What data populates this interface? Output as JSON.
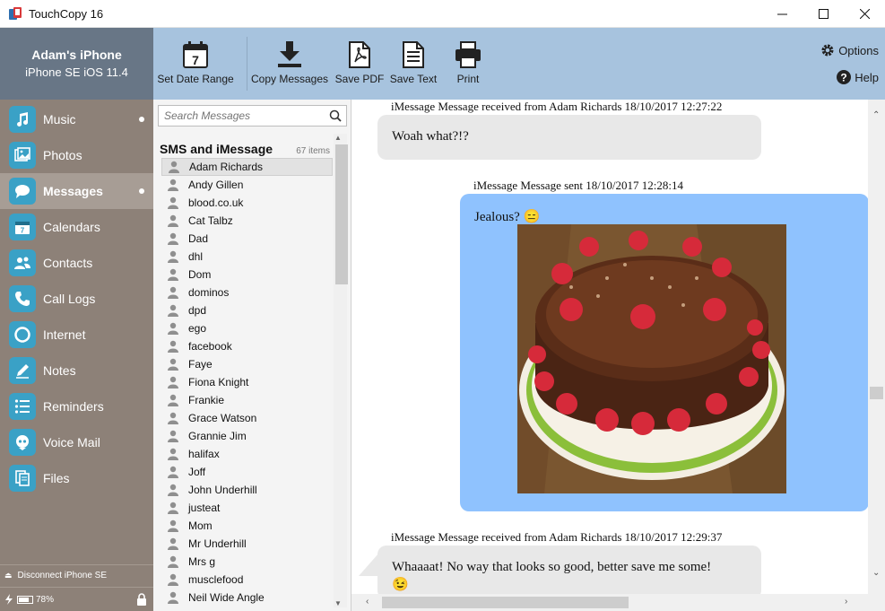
{
  "window": {
    "title": "TouchCopy 16"
  },
  "device": {
    "name": "Adam's iPhone",
    "model": "iPhone SE iOS 11.4"
  },
  "nav": [
    {
      "label": "Music",
      "dot": true,
      "active": false,
      "icon": "music-icon"
    },
    {
      "label": "Photos",
      "dot": false,
      "active": false,
      "icon": "photos-icon"
    },
    {
      "label": "Messages",
      "dot": true,
      "active": true,
      "icon": "messages-icon"
    },
    {
      "label": "Calendars",
      "dot": false,
      "active": false,
      "icon": "calendar-icon"
    },
    {
      "label": "Contacts",
      "dot": false,
      "active": false,
      "icon": "contacts-icon"
    },
    {
      "label": "Call Logs",
      "dot": false,
      "active": false,
      "icon": "phone-icon"
    },
    {
      "label": "Internet",
      "dot": false,
      "active": false,
      "icon": "internet-icon"
    },
    {
      "label": "Notes",
      "dot": false,
      "active": false,
      "icon": "notes-icon"
    },
    {
      "label": "Reminders",
      "dot": false,
      "active": false,
      "icon": "reminders-icon"
    },
    {
      "label": "Voice Mail",
      "dot": false,
      "active": false,
      "icon": "voicemail-icon"
    },
    {
      "label": "Files",
      "dot": false,
      "active": false,
      "icon": "files-icon"
    }
  ],
  "sidebar_footer": {
    "disconnect": "Disconnect iPhone SE",
    "battery": "78%"
  },
  "calendar_day": "7",
  "toolbar": {
    "set_date_range": "Set Date Range",
    "copy_messages": "Copy Messages",
    "save_pdf": "Save PDF",
    "save_text": "Save Text",
    "print": "Print",
    "options": "Options",
    "help": "Help"
  },
  "search": {
    "placeholder": "Search Messages"
  },
  "list": {
    "title": "SMS and iMessage",
    "count": "67 items",
    "contacts": [
      "Adam Richards",
      "Andy Gillen",
      "blood.co.uk",
      "Cat Talbz",
      "Dad",
      "dhl",
      "Dom",
      "dominos",
      "dpd",
      "ego",
      "facebook",
      "Faye",
      "Fiona Knight",
      "Frankie",
      "Grace Watson",
      "Grannie Jim",
      "halifax",
      "Joff",
      "John Underhill",
      "justeat",
      "Mom",
      "Mr Underhill",
      "Mrs g",
      "musclefood",
      "Neil Wide Angle"
    ],
    "selected": "Adam Richards"
  },
  "messages": [
    {
      "meta": "iMessage Message received from Adam Richards 18/10/2017 12:27:22",
      "text": "Woah what?!?",
      "direction": "in"
    },
    {
      "meta": "iMessage Message sent 18/10/2017 12:28:14",
      "text": "Jealous? 😑",
      "direction": "out",
      "has_image": true
    },
    {
      "meta": "iMessage Message received from Adam Richards 18/10/2017 12:29:37",
      "text": "Whaaaat! No way that looks so good, better save me some!",
      "emoji": "😉",
      "direction": "in"
    }
  ],
  "colors": {
    "sidebar": "#8d8178",
    "device_header": "#687686",
    "toolbar": "#a7c3de",
    "nav_icon": "#3aa1c6",
    "bubble_out": "#8fc2fe",
    "bubble_in": "#e8e8e8"
  }
}
